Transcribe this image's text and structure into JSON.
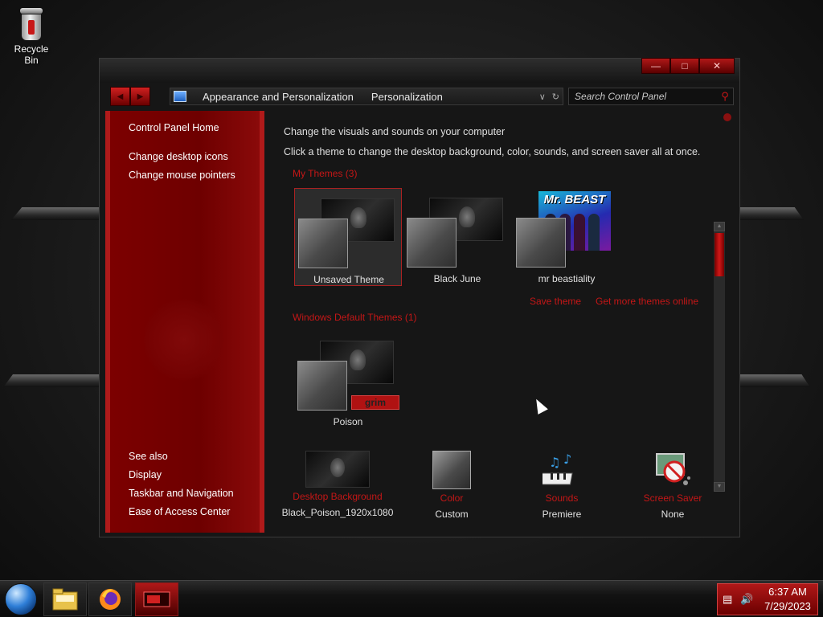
{
  "desktop": {
    "recycle_bin_label": "Recycle Bin"
  },
  "window": {
    "title": "",
    "caption_buttons": [
      "minimize",
      "maximize",
      "close"
    ]
  },
  "navigation": {
    "breadcrumb": [
      "Appearance and Personalization",
      "Personalization"
    ],
    "search_placeholder": "Search Control Panel"
  },
  "sidebar": {
    "home_link": "Control Panel Home",
    "tasks": [
      "Change desktop icons",
      "Change mouse pointers"
    ],
    "see_also_heading": "See also",
    "see_also_links": [
      "Display",
      "Taskbar and Navigation",
      "Ease of Access Center"
    ]
  },
  "main": {
    "heading": "Change the visuals and sounds on your computer",
    "description": "Click a theme to change the desktop background, color, sounds, and screen saver all at once.",
    "my_themes_heading": "My Themes (3)",
    "my_themes": [
      {
        "name": "Unsaved Theme",
        "selected": true
      },
      {
        "name": "Black June",
        "selected": false
      },
      {
        "name": "mr beastiality",
        "selected": false,
        "poster_text": "Mr. BEAST"
      }
    ],
    "save_theme_link": "Save theme",
    "get_more_themes_link": "Get more themes online",
    "default_themes_heading": "Windows Default Themes (1)",
    "default_themes": [
      {
        "name": "Poison",
        "badge_text": "grim"
      }
    ]
  },
  "bottom_options": [
    {
      "title": "Desktop Background",
      "value": "Black_Poison_1920x1080"
    },
    {
      "title": "Color",
      "value": "Custom"
    },
    {
      "title": "Sounds",
      "value": "Premiere"
    },
    {
      "title": "Screen Saver",
      "value": "None"
    }
  ],
  "taskbar": {
    "clock_time": "6:37 AM",
    "clock_date": "7/29/2023"
  },
  "colors": {
    "accent_red": "#c41616",
    "sidebar_red": "#7c0000",
    "window_bg": "#161616"
  }
}
